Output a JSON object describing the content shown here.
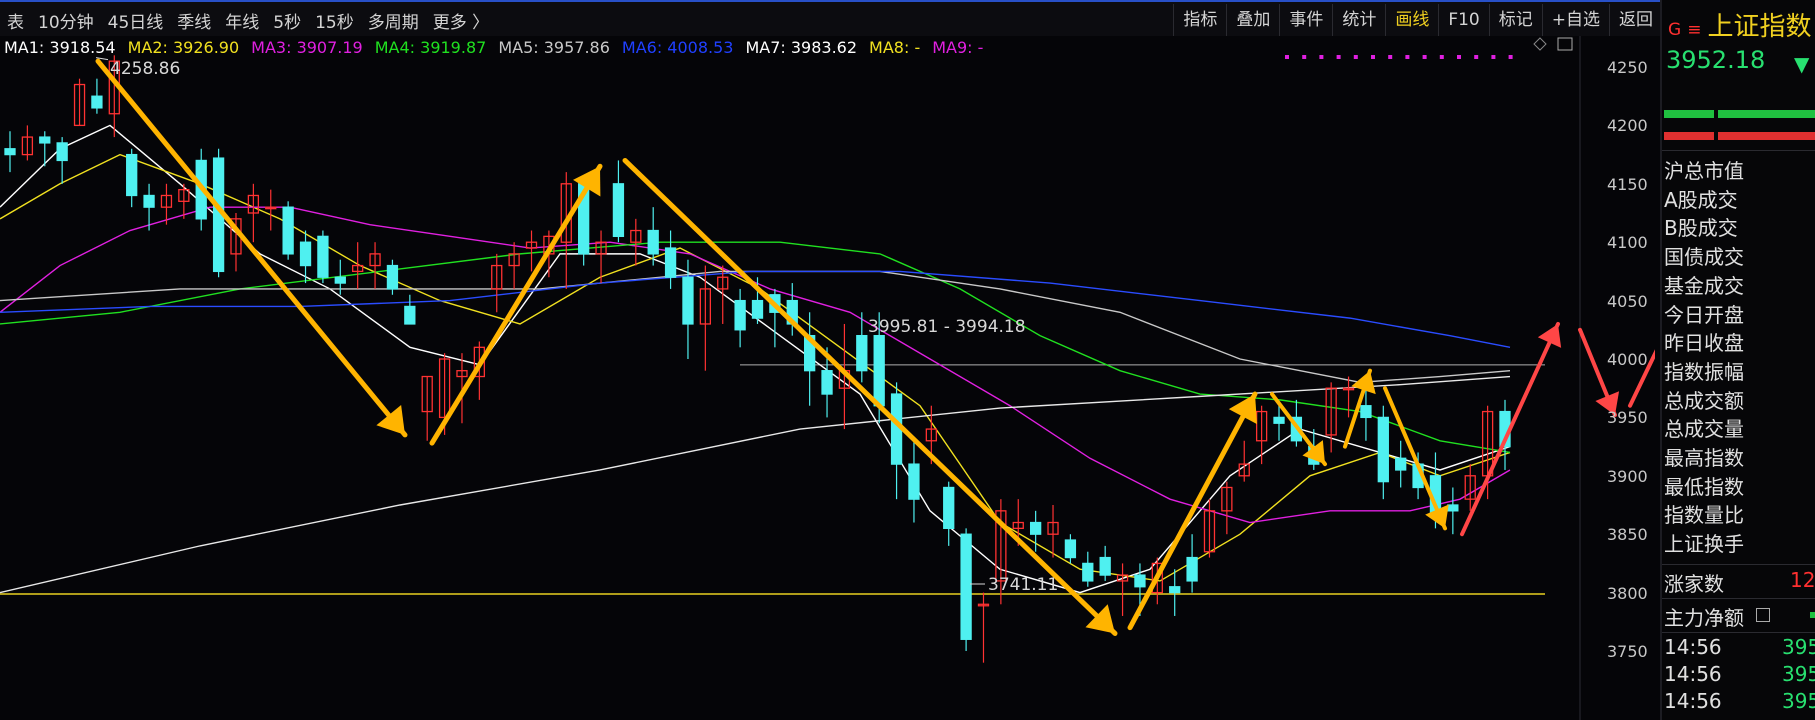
{
  "periods": [
    "表",
    "10分钟",
    "45日线",
    "季线",
    "年线",
    "5秒",
    "15秒",
    "多周期",
    "更多 〉"
  ],
  "tools": [
    "指标",
    "叠加",
    "事件",
    "统计",
    "画线",
    "F10",
    "标记",
    "+自选",
    "返回"
  ],
  "active_tool": "画线",
  "ma": [
    {
      "label": "MA1: 3918.54",
      "color": "#ffffff"
    },
    {
      "label": "MA2: 3926.90",
      "color": "#f0e020"
    },
    {
      "label": "MA3: 3907.19",
      "color": "#e020e0"
    },
    {
      "label": "MA4: 3919.87",
      "color": "#20e020"
    },
    {
      "label": "MA5: 3957.86",
      "color": "#c8c8c8"
    },
    {
      "label": "MA6: 4008.53",
      "color": "#2040ff"
    },
    {
      "label": "MA7: 3983.62",
      "color": "#ffffff"
    },
    {
      "label": "MA8: -",
      "color": "#f0e020"
    },
    {
      "label": "MA9: -",
      "color": "#e020e0"
    }
  ],
  "axis_ticks": [
    "4250",
    "4200",
    "4150",
    "4100",
    "4050",
    "4000",
    "3950",
    "3900",
    "3850",
    "3800",
    "3750"
  ],
  "annotations": {
    "high": "4258.86",
    "low": "3741.11",
    "level": "3995.81 - 3994.18"
  },
  "colors": {
    "up": "#ff3232",
    "down": "#4ff0f0",
    "arrow": "#ffb400",
    "red_arrow": "#ff4646"
  },
  "candles": [
    [
      4180,
      4195,
      4160,
      4175
    ],
    [
      4175,
      4200,
      4170,
      4190
    ],
    [
      4190,
      4195,
      4165,
      4185
    ],
    [
      4185,
      4190,
      4150,
      4170
    ],
    [
      4200,
      4240,
      4200,
      4235
    ],
    [
      4225,
      4240,
      4210,
      4215
    ],
    [
      4210,
      4260,
      4190,
      4255
    ],
    [
      4175,
      4180,
      4130,
      4140
    ],
    [
      4140,
      4150,
      4110,
      4130
    ],
    [
      4130,
      4150,
      4115,
      4140
    ],
    [
      4135,
      4150,
      4120,
      4145
    ],
    [
      4170,
      4180,
      4110,
      4120
    ],
    [
      4172,
      4180,
      4070,
      4075
    ],
    [
      4090,
      4125,
      4075,
      4120
    ],
    [
      4125,
      4150,
      4100,
      4140
    ],
    [
      4130,
      4145,
      4110,
      4130
    ],
    [
      4130,
      4135,
      4085,
      4090
    ],
    [
      4100,
      4110,
      4065,
      4080
    ],
    [
      4105,
      4110,
      4065,
      4070
    ],
    [
      4070,
      4085,
      4055,
      4065
    ],
    [
      4075,
      4100,
      4060,
      4080
    ],
    [
      4080,
      4100,
      4060,
      4090
    ],
    [
      4080,
      4085,
      4055,
      4060
    ],
    [
      4045,
      4055,
      4030,
      4030
    ],
    [
      3955,
      3985,
      3930,
      3985
    ],
    [
      3950,
      4005,
      3935,
      4000
    ],
    [
      3985,
      4005,
      3945,
      3990
    ],
    [
      3985,
      4015,
      3965,
      4010
    ],
    [
      4060,
      4090,
      4040,
      4080
    ],
    [
      4080,
      4100,
      4060,
      4090
    ],
    [
      4095,
      4110,
      4075,
      4100
    ],
    [
      4090,
      4110,
      4070,
      4105
    ],
    [
      4100,
      4160,
      4060,
      4150
    ],
    [
      4150,
      4155,
      4080,
      4090
    ],
    [
      4090,
      4110,
      4065,
      4100
    ],
    [
      4150,
      4170,
      4100,
      4105
    ],
    [
      4100,
      4120,
      4080,
      4110
    ],
    [
      4110,
      4130,
      4080,
      4090
    ],
    [
      4095,
      4110,
      4060,
      4070
    ],
    [
      4070,
      4085,
      4000,
      4030
    ],
    [
      4030,
      4080,
      3990,
      4060
    ],
    [
      4060,
      4080,
      4030,
      4070
    ],
    [
      4050,
      4060,
      4010,
      4025
    ],
    [
      4050,
      4070,
      4030,
      4035
    ],
    [
      4055,
      4060,
      4010,
      4040
    ],
    [
      4050,
      4065,
      4020,
      4030
    ],
    [
      4020,
      4040,
      3960,
      3990
    ],
    [
      3990,
      4010,
      3950,
      3970
    ],
    [
      3975,
      4030,
      3940,
      3990
    ],
    [
      4020,
      4040,
      3980,
      3990
    ],
    [
      4020,
      4040,
      3945,
      3960
    ],
    [
      3970,
      3980,
      3880,
      3910
    ],
    [
      3910,
      3930,
      3860,
      3880
    ],
    [
      3930,
      3960,
      3910,
      3940
    ],
    [
      3890,
      3895,
      3840,
      3855
    ],
    [
      3850,
      3855,
      3750,
      3760
    ],
    [
      3790,
      3800,
      3740,
      3790
    ],
    [
      3810,
      3880,
      3790,
      3870
    ],
    [
      3855,
      3880,
      3840,
      3860
    ],
    [
      3860,
      3870,
      3835,
      3850
    ],
    [
      3850,
      3875,
      3830,
      3860
    ],
    [
      3845,
      3850,
      3825,
      3830
    ],
    [
      3825,
      3835,
      3805,
      3810
    ],
    [
      3830,
      3840,
      3810,
      3815
    ],
    [
      3810,
      3825,
      3780,
      3815
    ],
    [
      3815,
      3825,
      3780,
      3805
    ],
    [
      3800,
      3830,
      3790,
      3825
    ],
    [
      3805,
      3820,
      3780,
      3800
    ],
    [
      3830,
      3850,
      3800,
      3810
    ],
    [
      3835,
      3880,
      3830,
      3870
    ],
    [
      3870,
      3895,
      3850,
      3890
    ],
    [
      3900,
      3930,
      3895,
      3910
    ],
    [
      3930,
      3960,
      3910,
      3955
    ],
    [
      3950,
      3960,
      3930,
      3945
    ],
    [
      3950,
      3965,
      3925,
      3930
    ],
    [
      3925,
      3940,
      3905,
      3910
    ],
    [
      3935,
      3980,
      3920,
      3975
    ],
    [
      3975,
      3985,
      3950,
      3975
    ],
    [
      3960,
      3980,
      3930,
      3950
    ],
    [
      3950,
      3960,
      3880,
      3895
    ],
    [
      3915,
      3930,
      3890,
      3905
    ],
    [
      3910,
      3920,
      3880,
      3890
    ],
    [
      3900,
      3920,
      3855,
      3865
    ],
    [
      3875,
      3890,
      3850,
      3870
    ],
    [
      3880,
      3910,
      3870,
      3900
    ],
    [
      3900,
      3960,
      3880,
      3955
    ],
    [
      3955,
      3965,
      3905,
      3925
    ]
  ],
  "right_panel": {
    "g_mark": "G",
    "eq_mark": "≡",
    "title": "上证指数",
    "price": "3952.18",
    "price_arrow": "▼",
    "labels": [
      "沪总市值",
      "A股成交",
      "B股成交",
      "国债成交",
      "基金成交",
      "今日开盘",
      "昨日收盘",
      "指数振幅",
      "总成交额",
      "总成交量",
      "最高指数",
      "最低指数",
      "指数量比",
      "上证换手"
    ],
    "up_count_label": "涨家数",
    "up_count_value": "12",
    "main_flow_label": "主力净额",
    "ticks": [
      {
        "time": "14:56",
        "value": "395"
      },
      {
        "time": "14:56",
        "value": "395"
      },
      {
        "time": "14:56",
        "value": "395"
      }
    ]
  }
}
